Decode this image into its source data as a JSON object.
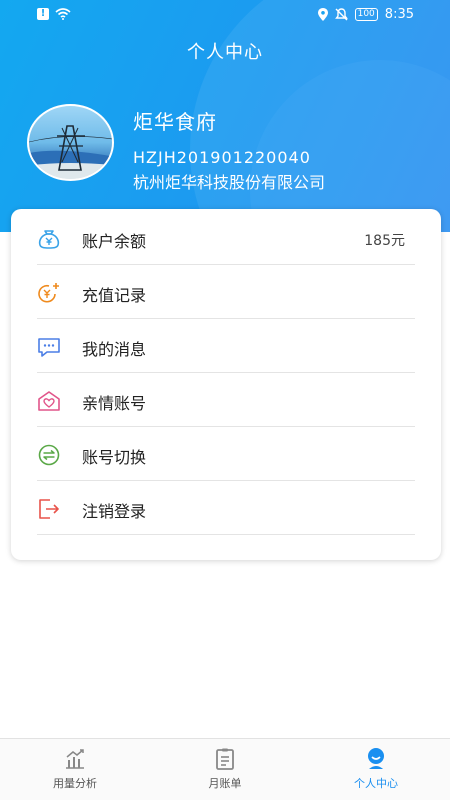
{
  "status_bar": {
    "battery": "100",
    "time": "8:35"
  },
  "header": {
    "title": "个人中心"
  },
  "profile": {
    "name": "炬华食府",
    "account_id": "HZJH201901220040",
    "company": "杭州炬华科技股份有限公司"
  },
  "menu": {
    "items": [
      {
        "label": "账户余额",
        "value": "185元",
        "icon": "wallet-yuan-icon",
        "color": "#3aa3e8"
      },
      {
        "label": "充值记录",
        "icon": "recharge-yuan-icon",
        "color": "#ef8a1d"
      },
      {
        "label": "我的消息",
        "icon": "message-icon",
        "color": "#4b7ee6"
      },
      {
        "label": "亲情账号",
        "icon": "family-heart-icon",
        "color": "#e1558a"
      },
      {
        "label": "账号切换",
        "icon": "switch-arrows-icon",
        "color": "#5aa847"
      },
      {
        "label": "注销登录",
        "icon": "logout-icon",
        "color": "#e8534a"
      }
    ]
  },
  "tabbar": {
    "tabs": [
      {
        "label": "用量分析",
        "icon": "chart-icon"
      },
      {
        "label": "月账单",
        "icon": "bill-icon"
      },
      {
        "label": "个人中心",
        "icon": "person-icon",
        "active": true
      }
    ],
    "active_color": "#1a8ff0"
  }
}
